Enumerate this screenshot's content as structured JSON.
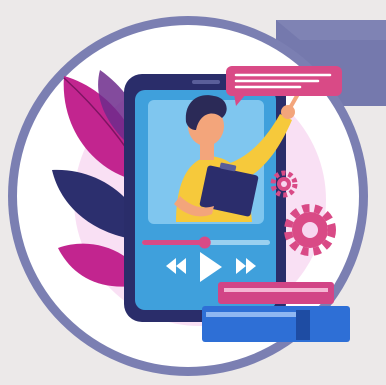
{
  "colors": {
    "background": "#ece9e9",
    "banner": "#7579ad",
    "ring": "#7b7fb2",
    "disc": "#ffffff",
    "glow": "#f7d6f0",
    "leaf_dark": "#2c2f6e",
    "leaf_magenta": "#c2258f",
    "leaf_purple": "#6d2c8c",
    "phone_body": "#2a2d6a",
    "phone_screen": "#3fa0dc",
    "person_shirt": "#f6c93b",
    "person_hair": "#2b2a57",
    "skin": "#f3a57b",
    "clipboard": "#2b2d6c",
    "speech_bubble": "#d94a86",
    "gear": "#d94a86",
    "book_pink": "#d24586",
    "book_blue": "#2e6fd6",
    "progress_fill": "#d94a86",
    "progress_track": "#9ad0f0",
    "controls": "#ffffff"
  },
  "media": {
    "progress_fraction": 0.49
  },
  "icons": {
    "rewind": "rewind-icon",
    "play": "play-icon",
    "fast_forward": "fast-forward-icon",
    "gear": "gear-icon",
    "speech": "speech-bubble-icon"
  }
}
